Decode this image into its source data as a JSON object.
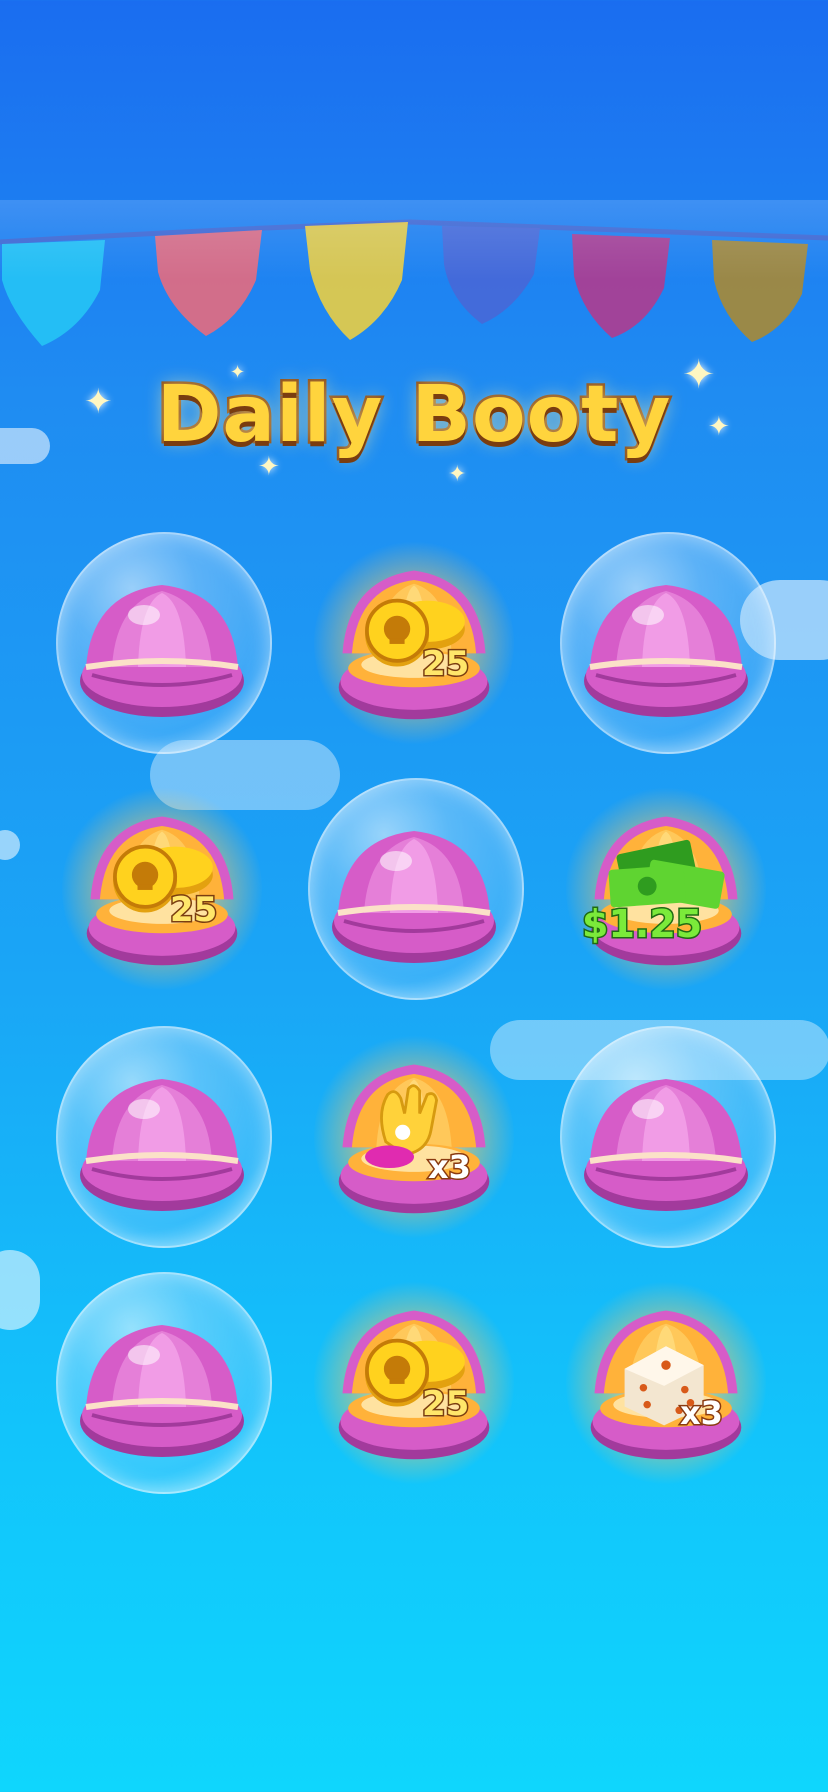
{
  "title": "Daily Booty",
  "colors": {
    "background_top": "#1a6df0",
    "background_bottom": "#0fd6fd",
    "title_fill": "#ffd43d",
    "title_outline": "#8a4a16",
    "shell_closed": "#d65cc8",
    "shell_open_inner": "#ffb23a",
    "coin": "#ffd21e",
    "cash": "#5fd431"
  },
  "bunting_flags": [
    "cyan-flag",
    "red-flag",
    "yellow-flag",
    "blue-flag",
    "magenta-flag",
    "gold-flag"
  ],
  "shells": [
    {
      "state": "closed",
      "reward_icon": "",
      "reward_label": ""
    },
    {
      "state": "open",
      "reward_icon": "coin-icon",
      "reward_label": "25"
    },
    {
      "state": "closed",
      "reward_icon": "",
      "reward_label": ""
    },
    {
      "state": "open",
      "reward_icon": "coin-icon",
      "reward_label": "25"
    },
    {
      "state": "closed",
      "reward_icon": "",
      "reward_label": ""
    },
    {
      "state": "open",
      "reward_icon": "cash-stack-icon",
      "reward_label": "$1.25"
    },
    {
      "state": "closed",
      "reward_icon": "",
      "reward_label": ""
    },
    {
      "state": "open",
      "reward_icon": "glove-icon",
      "reward_label": "x3"
    },
    {
      "state": "closed",
      "reward_icon": "",
      "reward_label": ""
    },
    {
      "state": "closed",
      "reward_icon": "",
      "reward_label": ""
    },
    {
      "state": "open",
      "reward_icon": "coin-icon",
      "reward_label": "25"
    },
    {
      "state": "open",
      "reward_icon": "dice-icon",
      "reward_label": "x3"
    }
  ]
}
